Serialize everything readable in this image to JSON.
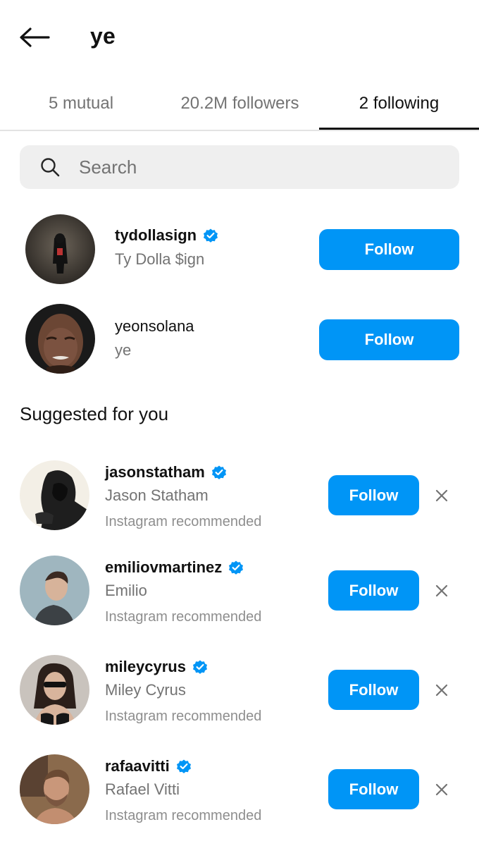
{
  "header": {
    "title": "ye",
    "back_icon": "arrow-left-icon"
  },
  "tabs": [
    {
      "label": "5 mutual",
      "active": false
    },
    {
      "label": "20.2M followers",
      "active": false
    },
    {
      "label": "2 following",
      "active": true
    }
  ],
  "search": {
    "placeholder": "Search",
    "value": "",
    "icon": "search-icon"
  },
  "following": [
    {
      "username": "tydollasign",
      "full_name": "Ty Dolla $ign",
      "verified": true,
      "button": "Follow"
    },
    {
      "username": "yeonsolana",
      "full_name": "ye",
      "verified": false,
      "button": "Follow"
    }
  ],
  "suggested": {
    "title": "Suggested for you",
    "items": [
      {
        "username": "jasonstatham",
        "full_name": "Jason Statham",
        "subtitle": "Instagram recommended",
        "verified": true,
        "button": "Follow"
      },
      {
        "username": "emiliovmartinez",
        "full_name": "Emilio",
        "subtitle": "Instagram recommended",
        "verified": true,
        "button": "Follow"
      },
      {
        "username": "mileycyrus",
        "full_name": "Miley Cyrus",
        "subtitle": "Instagram recommended",
        "verified": true,
        "button": "Follow"
      },
      {
        "username": "rafaavitti",
        "full_name": "Rafael Vitti",
        "subtitle": "Instagram recommended",
        "verified": true,
        "button": "Follow"
      }
    ]
  },
  "colors": {
    "accent": "#0095f6",
    "text": "#262626",
    "secondary": "#737373",
    "verified": "#0095f6"
  }
}
